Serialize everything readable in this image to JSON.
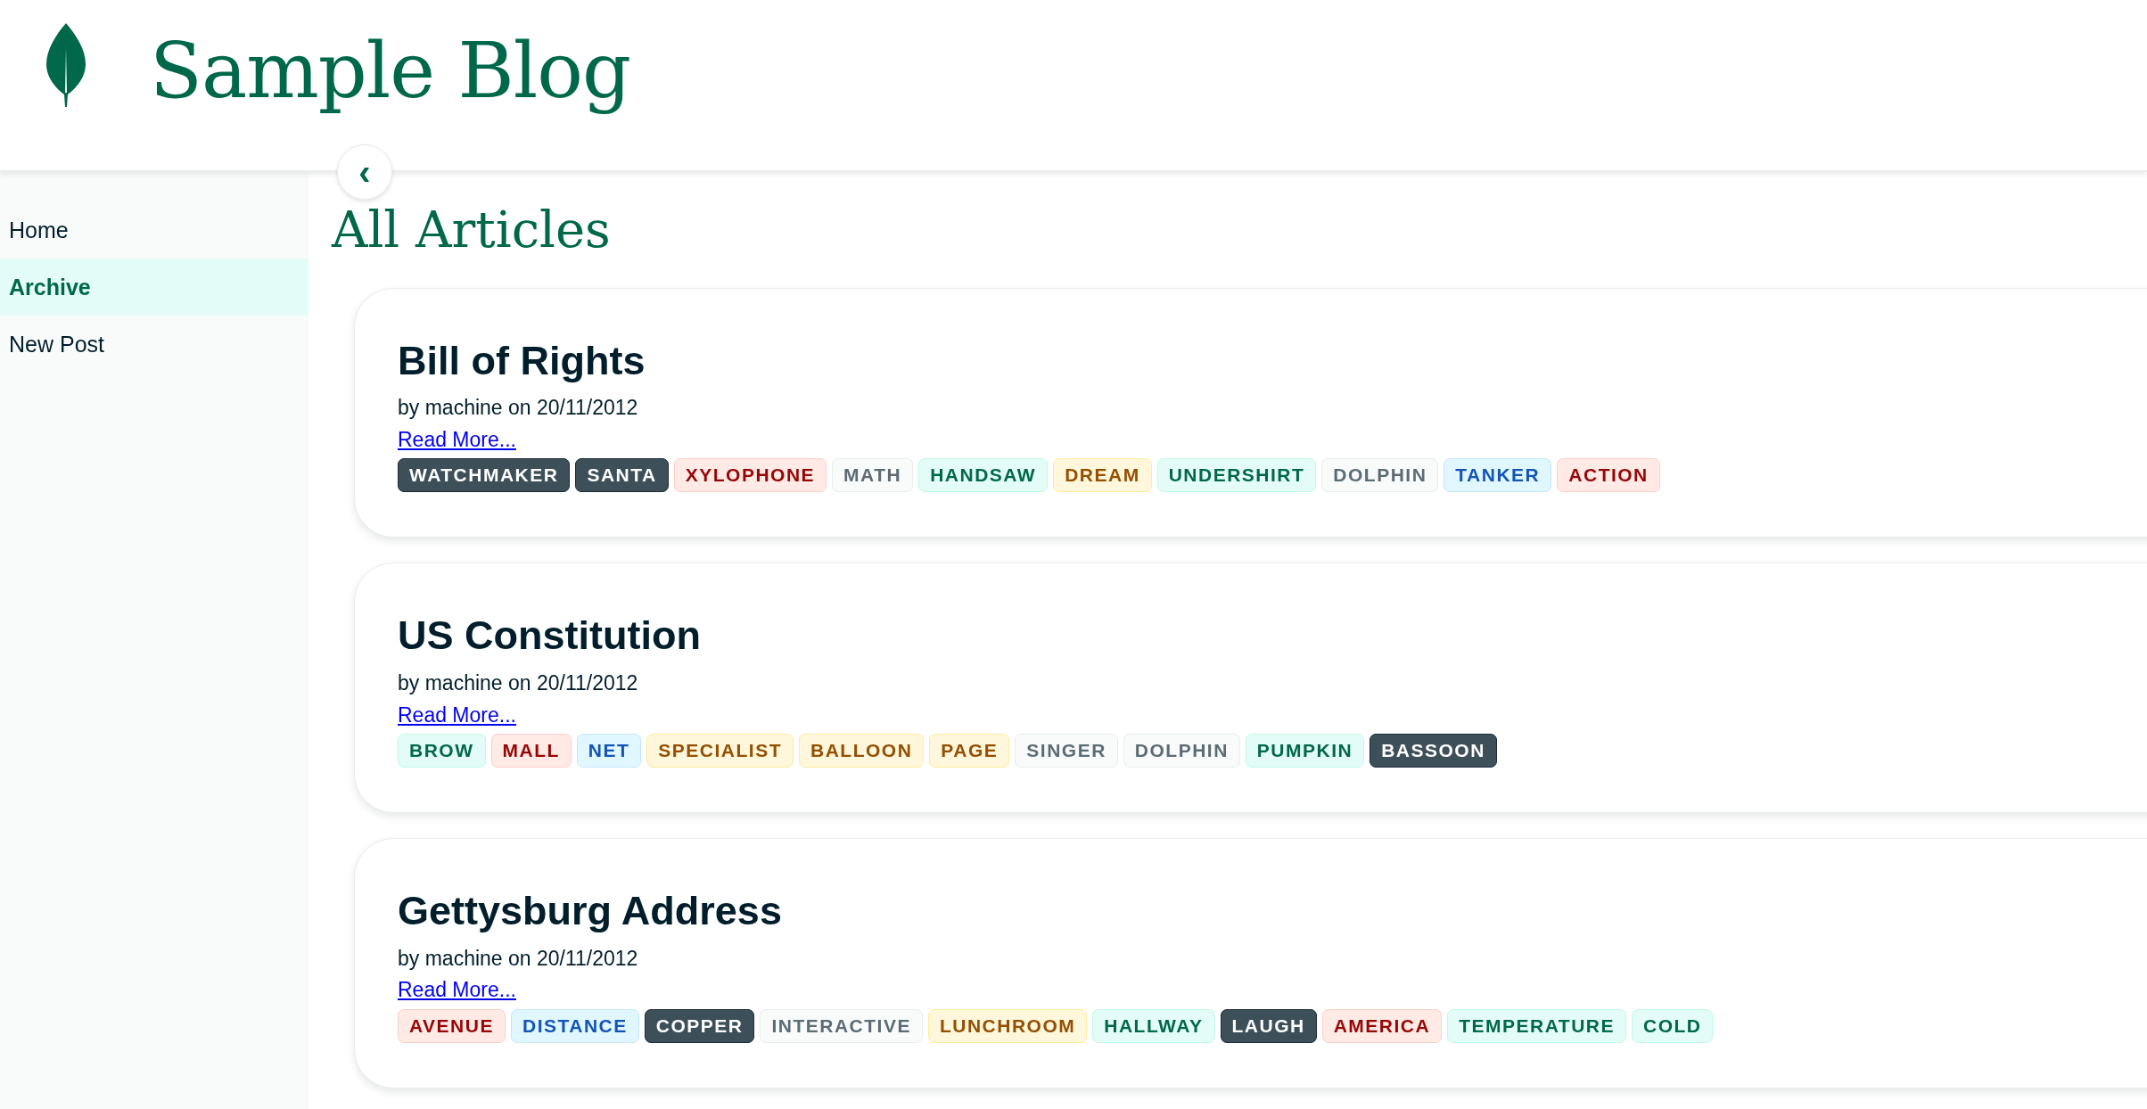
{
  "header": {
    "title": "Sample Blog"
  },
  "sidebar": {
    "items": [
      {
        "label": "Home",
        "selected": false
      },
      {
        "label": "Archive",
        "selected": true
      },
      {
        "label": "New Post",
        "selected": false
      }
    ]
  },
  "collapse_button": {
    "label": "‹"
  },
  "page_title": "All Articles",
  "articles": [
    {
      "title": "Bill of Rights",
      "byline": "by machine on 20/11/2012",
      "link": "Read More...",
      "tags": [
        {
          "label": "WATCHMAKER",
          "kind": "dark"
        },
        {
          "label": "SANTA",
          "kind": "dark"
        },
        {
          "label": "XYLOPHONE",
          "kind": "red"
        },
        {
          "label": "MATH",
          "kind": "gray"
        },
        {
          "label": "HANDSAW",
          "kind": "green"
        },
        {
          "label": "DREAM",
          "kind": "yellow"
        },
        {
          "label": "UNDERSHIRT",
          "kind": "green"
        },
        {
          "label": "DOLPHIN",
          "kind": "gray"
        },
        {
          "label": "TANKER",
          "kind": "blue"
        },
        {
          "label": "ACTION",
          "kind": "red"
        }
      ]
    },
    {
      "title": "US Constitution",
      "byline": "by machine on 20/11/2012",
      "link": "Read More...",
      "tags": [
        {
          "label": "BROW",
          "kind": "green"
        },
        {
          "label": "MALL",
          "kind": "red"
        },
        {
          "label": "NET",
          "kind": "blue"
        },
        {
          "label": "SPECIALIST",
          "kind": "yellow"
        },
        {
          "label": "BALLOON",
          "kind": "yellow"
        },
        {
          "label": "PAGE",
          "kind": "yellow"
        },
        {
          "label": "SINGER",
          "kind": "gray"
        },
        {
          "label": "DOLPHIN",
          "kind": "gray"
        },
        {
          "label": "PUMPKIN",
          "kind": "green"
        },
        {
          "label": "BASSOON",
          "kind": "dark"
        }
      ]
    },
    {
      "title": "Gettysburg Address",
      "byline": "by machine on 20/11/2012",
      "link": "Read More...",
      "tags": [
        {
          "label": "AVENUE",
          "kind": "red"
        },
        {
          "label": "DISTANCE",
          "kind": "blue"
        },
        {
          "label": "COPPER",
          "kind": "dark"
        },
        {
          "label": "INTERACTIVE",
          "kind": "gray"
        },
        {
          "label": "LUNCHROOM",
          "kind": "yellow"
        },
        {
          "label": "HALLWAY",
          "kind": "green"
        },
        {
          "label": "LAUGH",
          "kind": "dark"
        },
        {
          "label": "AMERICA",
          "kind": "red"
        },
        {
          "label": "TEMPERATURE",
          "kind": "green"
        },
        {
          "label": "COLD",
          "kind": "green"
        }
      ]
    }
  ]
}
